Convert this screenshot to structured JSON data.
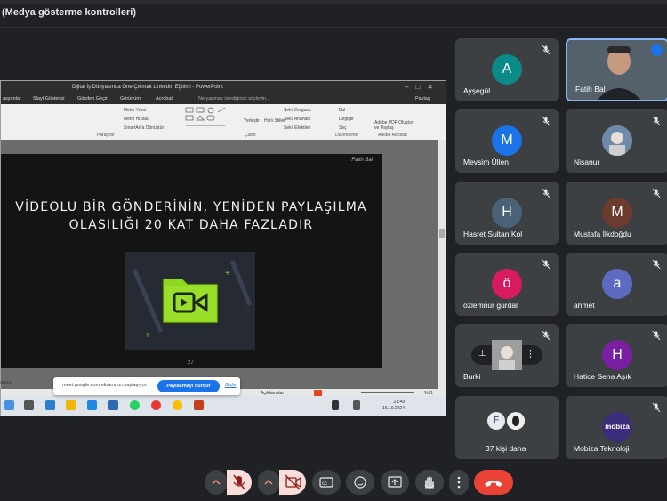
{
  "topbar": {
    "title": "(Medya gösterme kontrolleri)"
  },
  "powerpoint": {
    "window_title": "Dijital İş Dünyasında Öne Çıkmak LinkedIn Eğitimi - PowerPoint",
    "tabs": [
      "asyonlar",
      "Slayt Gösterisi",
      "Gözden Geçir",
      "Görünüm",
      "Acrobat",
      "Ne yapmak istediğinizi söyleyin...",
      "Paylaş"
    ],
    "ribbon_groups": [
      "Paragraf",
      "Çizim",
      "Düzenleme",
      "Adobe Acrobat"
    ],
    "ribbon_items": [
      "Metin Yönü",
      "Metni Hizala",
      "SmartArt'a Dönüştür",
      "Yerleştir",
      "Hızlı Stiller",
      "Şekil Dolgusu",
      "Şekil Anahattı",
      "Şekil Efektleri",
      "Bul",
      "Değiştir",
      "Seç",
      "Adobe PDF Oluştur ve Paylaş"
    ],
    "slide": {
      "signature": "Fatih Bal",
      "headline_line1": "VİDEOLU BİR GÖNDERİNİN, YENİDEN PAYLAŞILMA",
      "headline_line2": "OLASILIĞI 20 KAT DAHA FAZLADIR",
      "page_number": "27"
    },
    "status": {
      "notes": "Açıklamalar",
      "zoom": "%91"
    },
    "clock": {
      "time": "21:49",
      "date": "16.10.2024"
    }
  },
  "share_bar": {
    "message": "meet.google.com ekranınızı paylaşıyor.",
    "stop_label": "Paylaşmayı durdur",
    "hide_label": "Gizle"
  },
  "left_label": "ılatın",
  "participants": [
    {
      "name": "Ayşegül",
      "initial": "A",
      "color": "#0b8a8a",
      "muted": true
    },
    {
      "name": "Fatih Bal",
      "initial": "",
      "color": "#5f6368",
      "muted": false,
      "video": true
    },
    {
      "name": "Mevsim Üllen",
      "initial": "M",
      "color": "#1a73e8",
      "muted": true
    },
    {
      "name": "Nisanur",
      "initial": "",
      "color": "#6d8aa8",
      "muted": true,
      "image": true
    },
    {
      "name": "Hasret Sultan Kol",
      "initial": "H",
      "color": "#4a6278",
      "muted": true
    },
    {
      "name": "Mustafa İlkdoğdu",
      "initial": "M",
      "color": "#6d3a2e",
      "muted": true
    },
    {
      "name": "özlemnur gürdal",
      "initial": "ö",
      "color": "#d81b60",
      "muted": true
    },
    {
      "name": "ahmet",
      "initial": "a",
      "color": "#5c6bc0",
      "muted": true
    },
    {
      "name": "Burki",
      "initial": "",
      "color": "#9e9e9e",
      "muted": true,
      "image": true
    },
    {
      "name": "Hatice Sena Aşık",
      "initial": "H",
      "color": "#7b1fa2",
      "muted": true
    },
    {
      "name": "37 kişi daha",
      "initial": "F",
      "color": "#1e3a5f",
      "muted": false
    },
    {
      "name": "Mobiza Teknoloji",
      "initial": "mobiza",
      "color": "#3b2d7a",
      "muted": true
    }
  ]
}
